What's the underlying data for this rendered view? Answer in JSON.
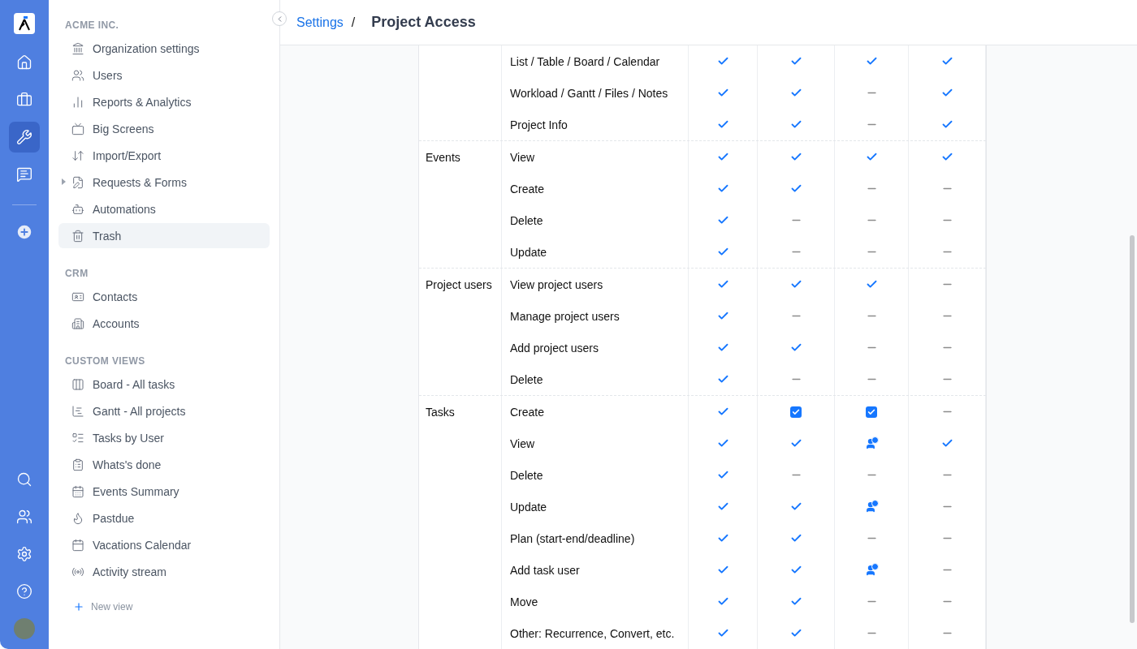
{
  "rail": {
    "items": [
      {
        "selected": false
      },
      {
        "selected": false
      },
      {
        "selected": true
      },
      {
        "selected": false
      }
    ]
  },
  "sidebar": {
    "sections": [
      {
        "title": "ACME INC.",
        "items": [
          {
            "label": "Organization settings",
            "selected": false
          },
          {
            "label": "Users",
            "selected": false
          },
          {
            "label": "Reports & Analytics",
            "selected": false
          },
          {
            "label": "Big Screens",
            "selected": false
          },
          {
            "label": "Import/Export",
            "selected": false
          },
          {
            "label": "Requests & Forms",
            "selected": false,
            "expanded": false
          },
          {
            "label": "Automations",
            "selected": false
          },
          {
            "label": "Trash",
            "selected": true
          }
        ]
      },
      {
        "title": "CRM",
        "items": [
          {
            "label": "Contacts",
            "selected": false
          },
          {
            "label": "Accounts",
            "selected": false
          }
        ]
      },
      {
        "title": "CUSTOM VIEWS",
        "items": [
          {
            "label": "Board - All tasks",
            "selected": false
          },
          {
            "label": "Gantt - All projects",
            "selected": false
          },
          {
            "label": "Tasks by User",
            "selected": false
          },
          {
            "label": "Whats's done",
            "selected": false
          },
          {
            "label": "Events Summary",
            "selected": false
          },
          {
            "label": "Pastdue",
            "selected": false
          },
          {
            "label": "Vacations Calendar",
            "selected": false
          },
          {
            "label": "Activity stream",
            "selected": false
          }
        ]
      }
    ],
    "new_view": "New view"
  },
  "breadcrumb": {
    "parent": "Settings",
    "separator": "/",
    "current": "Project Access"
  },
  "table": {
    "groups": [
      {
        "rows": [
          {
            "action": "List / Table / Board / Calendar",
            "cells": [
              {
                "kind": "check"
              },
              {
                "kind": "check"
              },
              {
                "kind": "check"
              },
              {
                "kind": "check"
              }
            ]
          },
          {
            "action": "Workload / Gantt / Files / Notes",
            "cells": [
              {
                "kind": "check"
              },
              {
                "kind": "check"
              },
              {
                "kind": "none"
              },
              {
                "kind": "check"
              }
            ]
          },
          {
            "action": "Project Info",
            "cells": [
              {
                "kind": "check"
              },
              {
                "kind": "check"
              },
              {
                "kind": "none"
              },
              {
                "kind": "check"
              }
            ]
          }
        ]
      },
      {
        "name": "Events",
        "rows": [
          {
            "action": "View",
            "cells": [
              {
                "kind": "check"
              },
              {
                "kind": "check"
              },
              {
                "kind": "check"
              },
              {
                "kind": "check"
              }
            ]
          },
          {
            "action": "Create",
            "cells": [
              {
                "kind": "check"
              },
              {
                "kind": "check"
              },
              {
                "kind": "none"
              },
              {
                "kind": "none"
              }
            ]
          },
          {
            "action": "Delete",
            "cells": [
              {
                "kind": "check"
              },
              {
                "kind": "none"
              },
              {
                "kind": "none"
              },
              {
                "kind": "none"
              }
            ]
          },
          {
            "action": "Update",
            "cells": [
              {
                "kind": "check"
              },
              {
                "kind": "none"
              },
              {
                "kind": "none"
              },
              {
                "kind": "none"
              }
            ]
          }
        ]
      },
      {
        "name": "Project users",
        "rows": [
          {
            "action": "View project users",
            "cells": [
              {
                "kind": "check"
              },
              {
                "kind": "check"
              },
              {
                "kind": "check"
              },
              {
                "kind": "none"
              }
            ]
          },
          {
            "action": "Manage project users",
            "cells": [
              {
                "kind": "check"
              },
              {
                "kind": "none"
              },
              {
                "kind": "none"
              },
              {
                "kind": "none"
              }
            ]
          },
          {
            "action": "Add project users",
            "cells": [
              {
                "kind": "check"
              },
              {
                "kind": "check"
              },
              {
                "kind": "none"
              },
              {
                "kind": "none"
              }
            ]
          },
          {
            "action": "Delete",
            "cells": [
              {
                "kind": "check"
              },
              {
                "kind": "none"
              },
              {
                "kind": "none"
              },
              {
                "kind": "none"
              }
            ]
          }
        ]
      },
      {
        "name": "Tasks",
        "rows": [
          {
            "action": "Create",
            "cells": [
              {
                "kind": "check"
              },
              {
                "kind": "checkbox"
              },
              {
                "kind": "checkbox"
              },
              {
                "kind": "none"
              }
            ]
          },
          {
            "action": "View",
            "cells": [
              {
                "kind": "check"
              },
              {
                "kind": "check"
              },
              {
                "kind": "own"
              },
              {
                "kind": "check"
              }
            ]
          },
          {
            "action": "Delete",
            "cells": [
              {
                "kind": "check"
              },
              {
                "kind": "none"
              },
              {
                "kind": "none"
              },
              {
                "kind": "none"
              }
            ]
          },
          {
            "action": "Update",
            "cells": [
              {
                "kind": "check"
              },
              {
                "kind": "check"
              },
              {
                "kind": "own"
              },
              {
                "kind": "none"
              }
            ]
          },
          {
            "action": "Plan (start-end/deadline)",
            "cells": [
              {
                "kind": "check"
              },
              {
                "kind": "check"
              },
              {
                "kind": "none"
              },
              {
                "kind": "none"
              }
            ]
          },
          {
            "action": "Add task user",
            "cells": [
              {
                "kind": "check"
              },
              {
                "kind": "check"
              },
              {
                "kind": "own"
              },
              {
                "kind": "none"
              }
            ]
          },
          {
            "action": "Move",
            "cells": [
              {
                "kind": "check"
              },
              {
                "kind": "check"
              },
              {
                "kind": "none"
              },
              {
                "kind": "none"
              }
            ]
          },
          {
            "action": "Other: Recurrence, Convert, etc.",
            "cells": [
              {
                "kind": "check"
              },
              {
                "kind": "check"
              },
              {
                "kind": "none"
              },
              {
                "kind": "none"
              }
            ]
          }
        ]
      }
    ]
  }
}
